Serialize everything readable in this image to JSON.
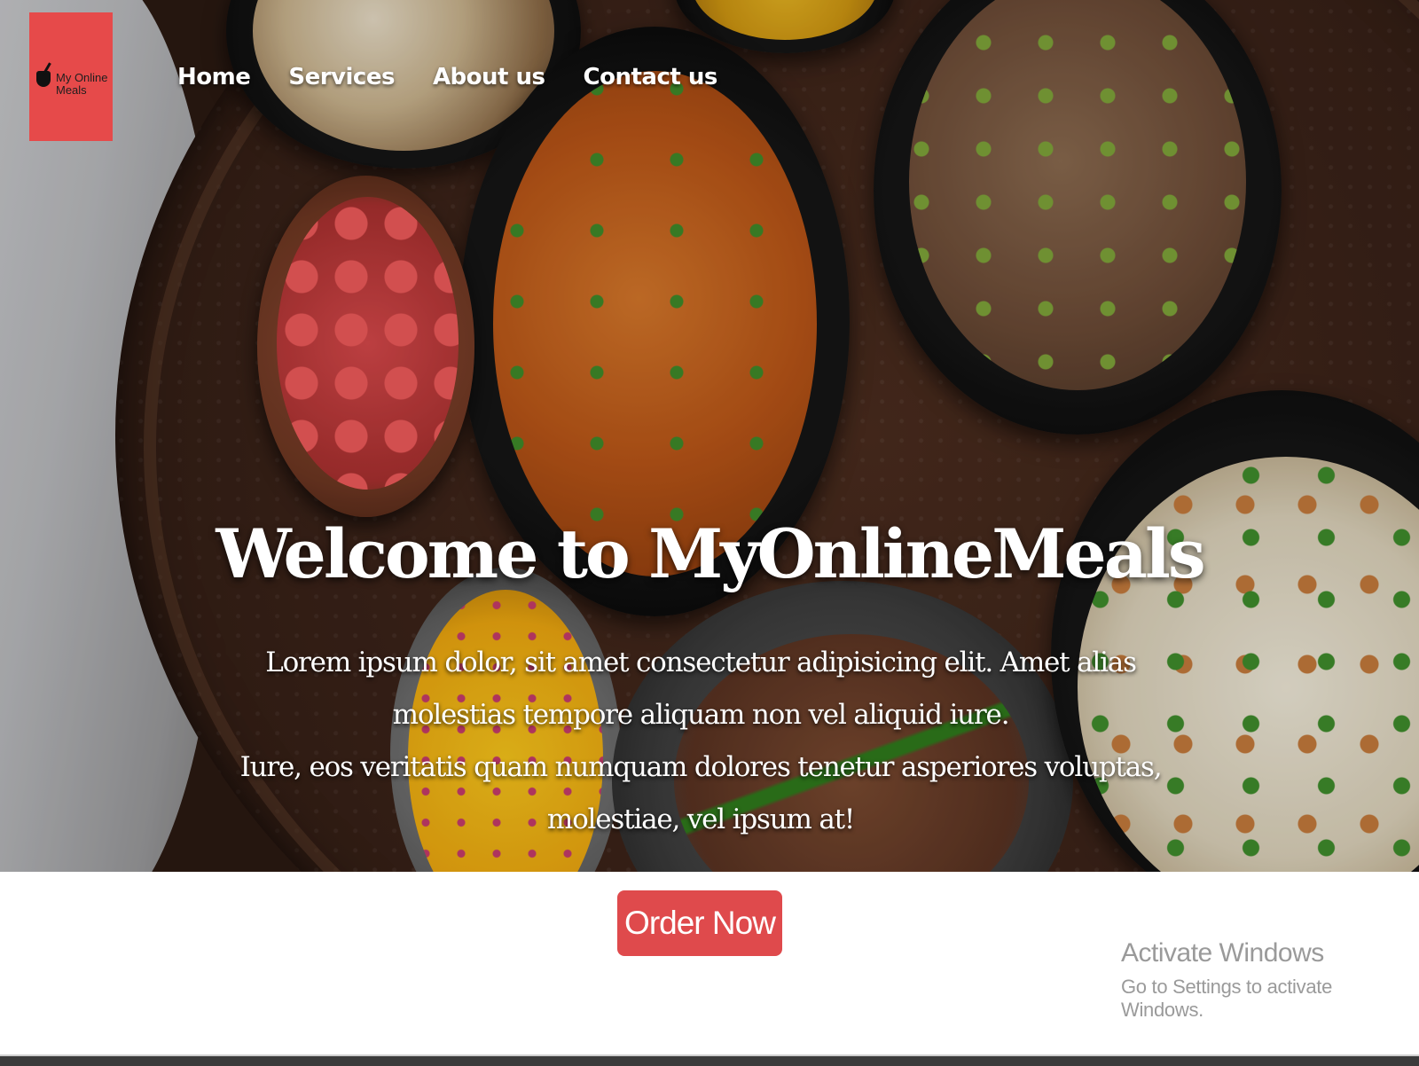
{
  "logo": {
    "line1": "My Online",
    "line2": "Meals"
  },
  "nav": {
    "items": [
      "Home",
      "Services",
      "About us",
      "Contact us"
    ]
  },
  "hero": {
    "title": "Welcome to MyOnlineMeals",
    "paragraph1": "Lorem ipsum dolor, sit amet consectetur adipisicing elit. Amet alias molestias tempore aliquam non vel aliquid iure.",
    "paragraph2": "Iure, eos veritatis quam numquam dolores tenetur asperiores voluptas, molestiae, vel ipsum at!"
  },
  "cta": {
    "order_label": "Order Now"
  },
  "watermark": {
    "title": "Activate Windows",
    "subtitle": "Go to Settings to activate Windows."
  },
  "colors": {
    "accent": "#df4a4c",
    "logo_bg": "#e64a4a",
    "text_on_hero": "#ffffff"
  },
  "icons": {
    "logo": "chopsticks-bowl-icon"
  }
}
